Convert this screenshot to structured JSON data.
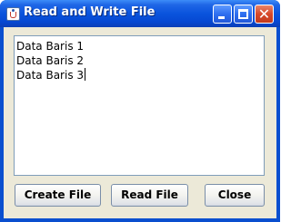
{
  "window": {
    "title": "Read and Write File",
    "controls": {
      "minimize": "minimize",
      "maximize": "maximize",
      "close": "close"
    }
  },
  "textarea": {
    "lines": [
      "Data Baris 1",
      "Data Baris 2",
      "Data Baris 3"
    ]
  },
  "buttons": {
    "create_file": "Create File",
    "read_file": "Read File",
    "close": "Close"
  },
  "icons": {
    "app": "java-cup-icon",
    "min": "minimize-icon",
    "max": "maximize-icon",
    "close": "close-icon"
  },
  "colors": {
    "titlebar": "#0a54dd",
    "client_bg": "#ece9d8",
    "close_button": "#d7482a"
  }
}
